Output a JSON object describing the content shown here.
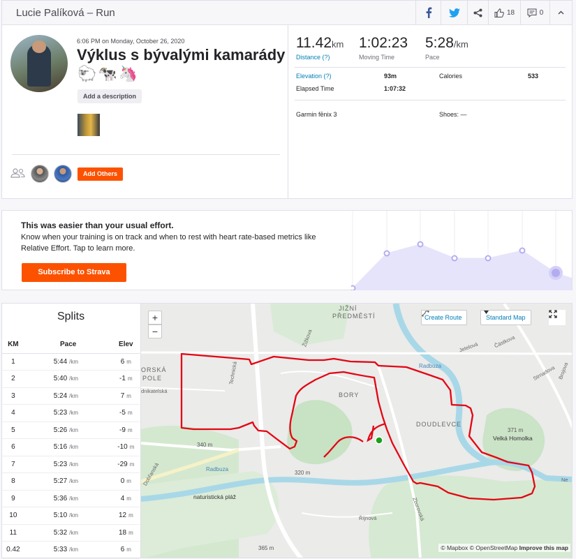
{
  "header": {
    "title": "Lucie Palíková – Run",
    "kudos_count": "18",
    "comments_count": "0"
  },
  "activity": {
    "date": "6:06 PM on Monday, October 26, 2020",
    "name": "Výklus s bývalými kamarády",
    "emoji": "🐑🐄🦄",
    "add_description": "Add a description",
    "add_others": "Add Others"
  },
  "stats": {
    "distance": {
      "value": "11.42",
      "unit": "km",
      "label": "Distance (?)"
    },
    "moving_time": {
      "value": "1:02:23",
      "label": "Moving Time"
    },
    "pace": {
      "value": "5:28",
      "unit": "/km",
      "label": "Pace"
    },
    "elevation": {
      "label": "Elevation (?)",
      "value": "93m"
    },
    "calories": {
      "label": "Calories",
      "value": "533"
    },
    "elapsed_time": {
      "label": "Elapsed Time",
      "value": "1:07:32"
    },
    "device": "Garmin fēnix 3",
    "shoes": "Shoes: —"
  },
  "effort": {
    "title": "This was easier than your usual effort.",
    "text": "Know when your training is on track and when to rest with heart rate-based metrics like Relative Effort. Tap to learn more.",
    "button": "Subscribe to Strava"
  },
  "splits": {
    "title": "Splits",
    "headers": [
      "KM",
      "Pace",
      "Elev"
    ],
    "pace_unit": "/km",
    "elev_unit": "m",
    "rows": [
      {
        "km": "1",
        "pace": "5:44",
        "elev": "6"
      },
      {
        "km": "2",
        "pace": "5:40",
        "elev": "-1"
      },
      {
        "km": "3",
        "pace": "5:24",
        "elev": "7"
      },
      {
        "km": "4",
        "pace": "5:23",
        "elev": "-5"
      },
      {
        "km": "5",
        "pace": "5:26",
        "elev": "-9"
      },
      {
        "km": "6",
        "pace": "5:16",
        "elev": "-10"
      },
      {
        "km": "7",
        "pace": "5:23",
        "elev": "-29"
      },
      {
        "km": "8",
        "pace": "5:27",
        "elev": "0"
      },
      {
        "km": "9",
        "pace": "5:36",
        "elev": "4"
      },
      {
        "km": "10",
        "pace": "5:10",
        "elev": "12"
      },
      {
        "km": "11",
        "pace": "5:32",
        "elev": "18"
      },
      {
        "km": "0.42",
        "pace": "5:33",
        "elev": "6"
      }
    ]
  },
  "map": {
    "zoom_in": "+",
    "zoom_out": "−",
    "create_route": "Create Route",
    "style": "Standard Map",
    "attribution_mapbox": "© Mapbox",
    "attribution_osm": "© OpenStreetMap",
    "improve": "Improve this map",
    "labels": {
      "jizni": "JIŽNÍ",
      "predmesti": "PŘEDMĚSTÍ",
      "bory": "BORY",
      "doudlevce": "DOUDLEVCE",
      "velka_homolka": "Velká Homolka",
      "homolka_elev": "371 m",
      "elev_340": "340 m",
      "elev_320": "320 m",
      "elev_365": "365 m",
      "naturisticka": "naturistická pláž",
      "radbuza1": "Radbuza",
      "radbuza2": "Radbuza",
      "ska": "ORSKÁ",
      "pole": "POLE",
      "technicka": "Technická",
      "nikatelska": "dnikatelská",
      "zizkova": "Žižkova",
      "jetelova": "Jetelová",
      "castkova": "Částkova",
      "strnadova": "Strnadova",
      "brojova": "Brojova",
      "dobranska": "Dobřanská",
      "zborovska": "Zborovská",
      "rijnova": "Říjnová",
      "ne": "Ne"
    }
  },
  "colors": {
    "brand": "#fc5200",
    "link": "#007fb6",
    "route": "#e30613",
    "effort_fill": "#e6e4fb",
    "effort_line": "#b3adf0"
  },
  "icons": {
    "facebook": "facebook-icon",
    "twitter": "twitter-icon",
    "share": "share-icon",
    "kudos": "thumbs-up-icon",
    "comment": "comment-icon",
    "menu": "chevron-up-icon"
  }
}
